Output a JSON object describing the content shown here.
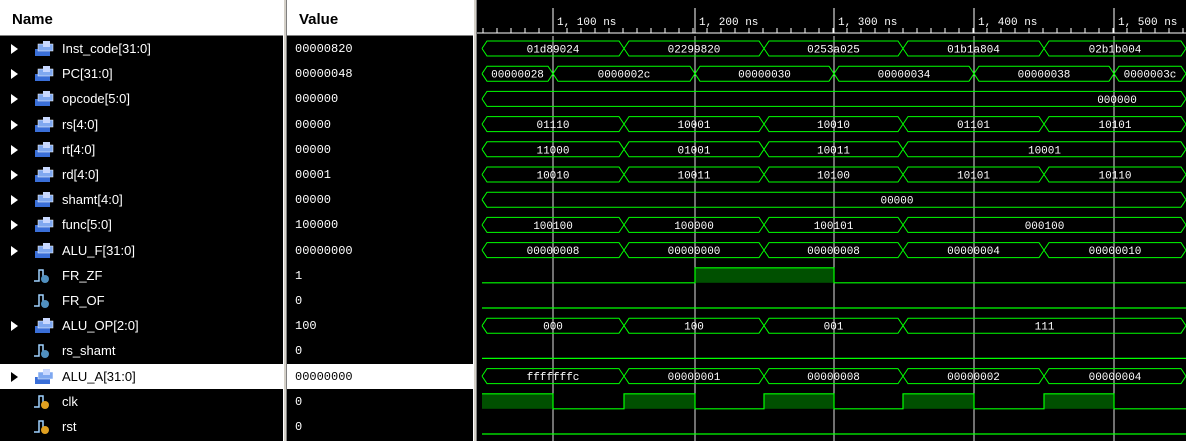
{
  "columns": {
    "name": "Name",
    "value": "Value"
  },
  "time_ticks": [
    "1, 100 ns",
    "1, 200 ns",
    "1, 300 ns",
    "1, 400 ns",
    "1, 500 ns"
  ],
  "colors": {
    "wave": "#00ff00",
    "wave_fill": "#005000",
    "cursor": "#e0e0e0",
    "background": "#000000"
  },
  "signals": [
    {
      "name": "Inst_code[31:0]",
      "value": "00000820",
      "type": "bus",
      "icon": "bus-signal-icon",
      "segments": [
        [
          "01d89024",
          "01d89024"
        ],
        [
          "02299820",
          "02299820"
        ],
        [
          "0253a025",
          "0253a025"
        ],
        [
          "01b1a804",
          "01b1a804"
        ],
        [
          "02b1b004",
          "02b1b004"
        ]
      ]
    },
    {
      "name": "PC[31:0]",
      "value": "00000048",
      "type": "bus",
      "icon": "bus-signal-icon",
      "segments": [
        [
          "00000028",
          "00000028"
        ],
        [
          "0000002c",
          "0000002c"
        ],
        [
          "00000030",
          "00000030"
        ],
        [
          "00000034",
          "00000034"
        ],
        [
          "00000038",
          "00000038"
        ],
        [
          "0000003c",
          "0000003c"
        ]
      ]
    },
    {
      "name": "opcode[5:0]",
      "value": "000000",
      "type": "bus",
      "icon": "bus-signal-icon",
      "segments": [
        [
          "000000",
          "000000"
        ]
      ]
    },
    {
      "name": "rs[4:0]",
      "value": "00000",
      "type": "bus",
      "icon": "bus-signal-icon",
      "segments": [
        [
          "01110",
          "01110"
        ],
        [
          "10001",
          "10001"
        ],
        [
          "10010",
          "10010"
        ],
        [
          "01101",
          "01101"
        ],
        [
          "10101",
          "10101"
        ]
      ]
    },
    {
      "name": "rt[4:0]",
      "value": "00000",
      "type": "bus",
      "icon": "bus-signal-icon",
      "segments": [
        [
          "11000",
          "11000"
        ],
        [
          "01001",
          "01001"
        ],
        [
          "10011",
          "10011"
        ],
        [
          "10001",
          "10001"
        ]
      ]
    },
    {
      "name": "rd[4:0]",
      "value": "00001",
      "type": "bus",
      "icon": "bus-signal-icon",
      "segments": [
        [
          "10010",
          "10010"
        ],
        [
          "10011",
          "10011"
        ],
        [
          "10100",
          "10100"
        ],
        [
          "10101",
          "10101"
        ],
        [
          "10110",
          "10110"
        ]
      ]
    },
    {
      "name": "shamt[4:0]",
      "value": "00000",
      "type": "bus",
      "icon": "bus-signal-icon",
      "segments": [
        [
          "00000",
          "00000"
        ]
      ]
    },
    {
      "name": "func[5:0]",
      "value": "100000",
      "type": "bus",
      "icon": "bus-signal-icon",
      "segments": [
        [
          "100100",
          "100100"
        ],
        [
          "100000",
          "100000"
        ],
        [
          "100101",
          "100101"
        ],
        [
          "000100",
          "000100"
        ]
      ]
    },
    {
      "name": "ALU_F[31:0]",
      "value": "00000000",
      "type": "bus",
      "icon": "bus-signal-icon",
      "segments": [
        [
          "00000008",
          "00000008"
        ],
        [
          "00000000",
          "00000000"
        ],
        [
          "00000008",
          "00000008"
        ],
        [
          "00000004",
          "00000004"
        ],
        [
          "00000010",
          "00000010"
        ]
      ]
    },
    {
      "name": "FR_ZF",
      "value": "1",
      "type": "bit",
      "icon": "bit-signal-icon",
      "levels": [
        0,
        1,
        0
      ]
    },
    {
      "name": "FR_OF",
      "value": "0",
      "type": "bit",
      "icon": "bit-signal-icon",
      "levels": [
        0
      ]
    },
    {
      "name": "ALU_OP[2:0]",
      "value": "100",
      "type": "bus",
      "icon": "bus-signal-icon",
      "segments": [
        [
          "000",
          "000"
        ],
        [
          "100",
          "100"
        ],
        [
          "001",
          "001"
        ],
        [
          "111",
          "111"
        ]
      ]
    },
    {
      "name": "rs_shamt",
      "value": "0",
      "type": "bit",
      "icon": "bit-signal-icon",
      "levels": [
        0
      ]
    },
    {
      "name": "ALU_A[31:0]",
      "value": "00000000",
      "type": "bus",
      "icon": "bus-signal-icon",
      "selected": true,
      "segments": [
        [
          "fffffffc",
          "fffffffc"
        ],
        [
          "00000001",
          "00000001"
        ],
        [
          "00000008",
          "00000008"
        ],
        [
          "00000002",
          "00000002"
        ],
        [
          "00000004",
          "00000004"
        ]
      ]
    },
    {
      "name": "clk",
      "value": "0",
      "type": "bit",
      "icon": "clock-signal-icon",
      "levels": [
        1,
        0,
        1,
        0,
        1,
        0,
        1,
        0,
        1,
        0,
        1
      ]
    },
    {
      "name": "rst",
      "value": "0",
      "type": "bit",
      "icon": "clock-signal-icon",
      "levels": [
        0
      ]
    }
  ]
}
